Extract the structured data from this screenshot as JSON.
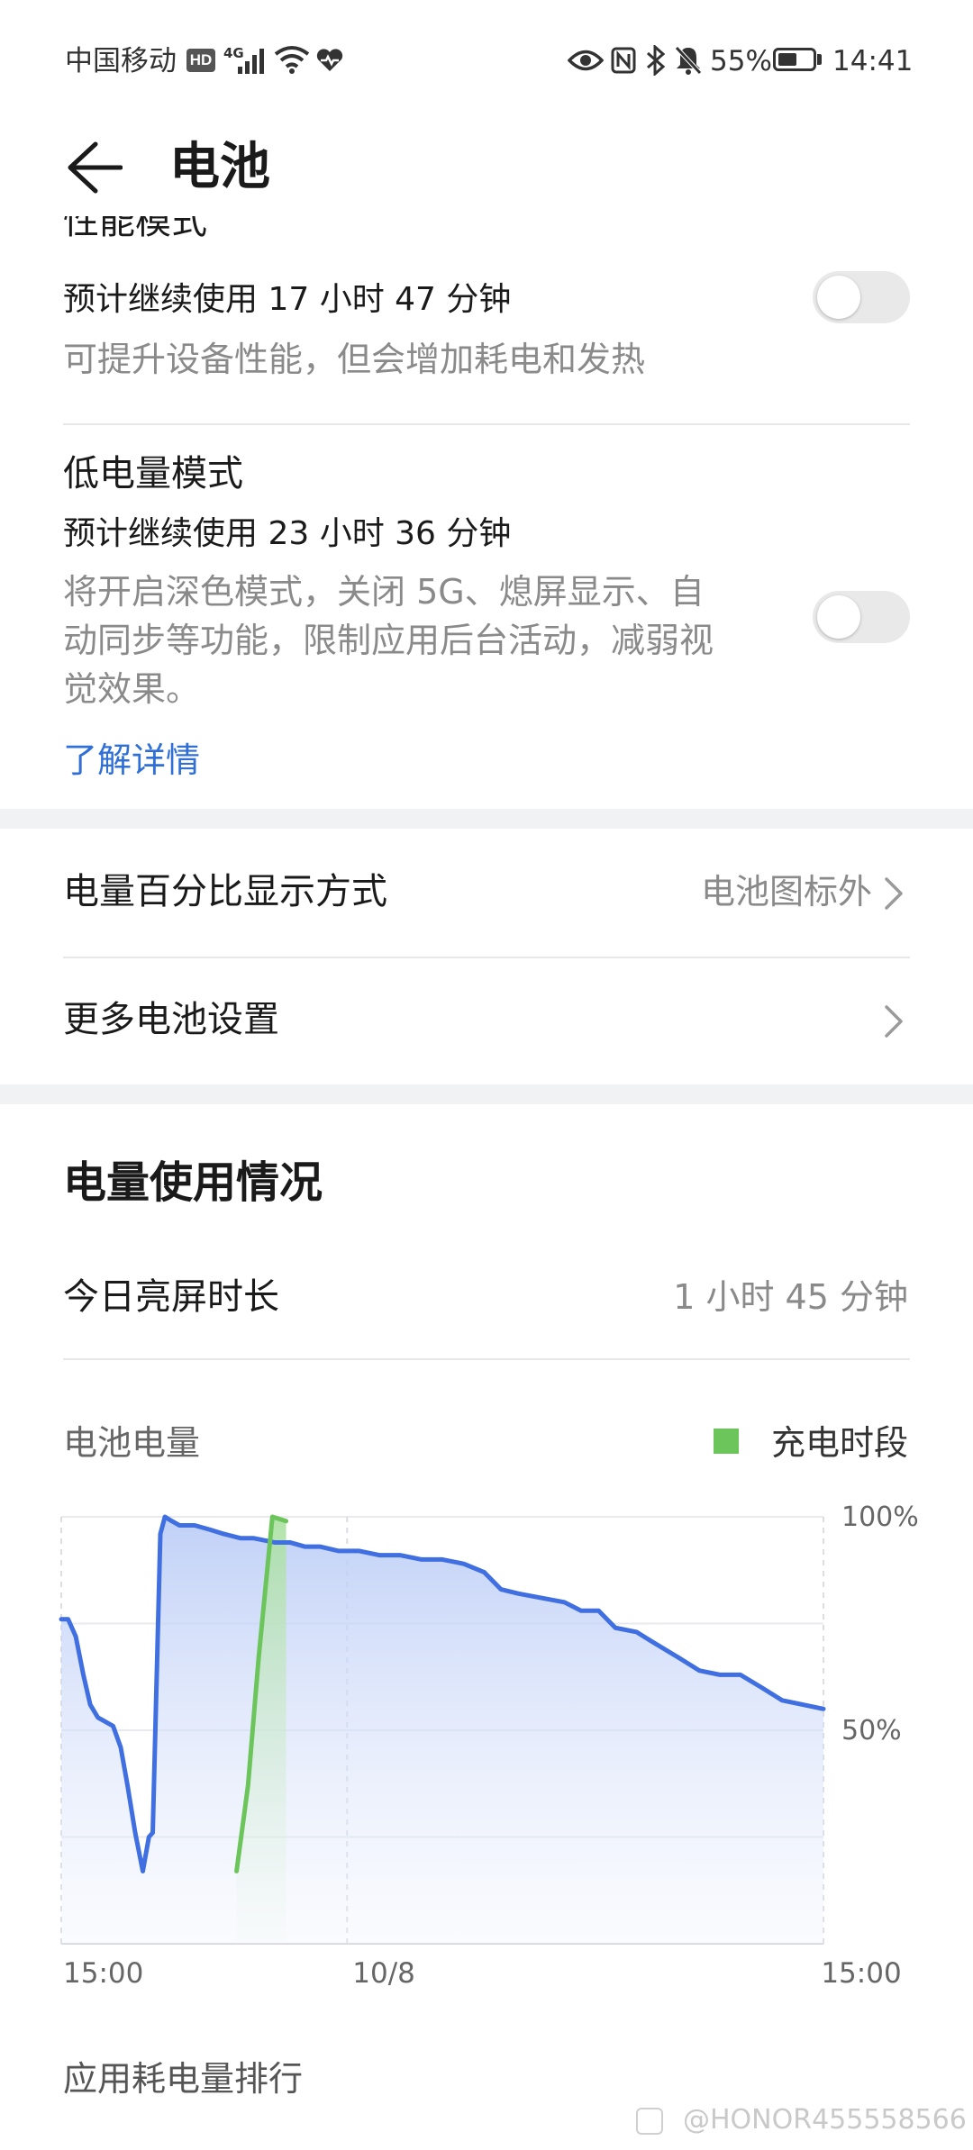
{
  "status_bar": {
    "carrier": "中国移动",
    "hd_badge": "HD",
    "network": "4G",
    "battery_percent": "55%",
    "time": "14:41",
    "battery_level": 0.55
  },
  "header": {
    "title": "电池"
  },
  "performance_mode": {
    "title": "性能模式",
    "estimate": "预计继续使用 17 小时 47 分钟",
    "description": "可提升设备性能，但会增加耗电和发热",
    "enabled": false
  },
  "low_power_mode": {
    "title": "低电量模式",
    "estimate": "预计继续使用 23 小时 36 分钟",
    "description_lines": [
      "将开启深色模式，关闭 5G、熄屏显示、自",
      "动同步等功能，限制应用后台活动，减弱视",
      "觉效果。"
    ],
    "enabled": false,
    "learn_more": "了解详情"
  },
  "settings": {
    "percentage_display": {
      "label": "电量百分比显示方式",
      "value": "电池图标外"
    },
    "more_settings": {
      "label": "更多电池设置"
    }
  },
  "usage": {
    "section_title": "电量使用情况",
    "screen_time_label": "今日亮屏时长",
    "screen_time_value": "1 小时 45 分钟",
    "chart_label": "电池电量",
    "charging_legend": "充电时段"
  },
  "colors": {
    "accent_link": "#2f6fd6",
    "usage_line": "#3f6fe0",
    "charging_line": "#6cc55b"
  },
  "chart_data": {
    "type": "area",
    "y_tick_labels": [
      "100%",
      "50%"
    ],
    "ylim": [
      0,
      100
    ],
    "x_tick_labels": [
      "15:00",
      "10/8",
      "15:00"
    ],
    "x_range_hours": [
      0,
      24
    ],
    "grid": true,
    "series": [
      {
        "name": "",
        "color": "#3f6fe0",
        "points": [
          [
            0,
            76
          ],
          [
            0.9,
            76
          ],
          [
            1.9,
            72
          ],
          [
            2.9,
            63
          ],
          [
            3.8,
            56
          ],
          [
            4.8,
            53
          ],
          [
            5.8,
            52
          ],
          [
            6.8,
            51
          ],
          [
            7.8,
            46
          ],
          [
            8.7,
            37
          ],
          [
            9.7,
            26
          ],
          [
            10.7,
            17
          ],
          [
            11.5,
            25
          ],
          [
            12,
            26
          ],
          [
            13,
            96
          ],
          [
            13.6,
            100
          ],
          [
            14.5,
            99
          ],
          [
            15.5,
            98
          ],
          [
            16.5,
            98
          ],
          [
            17.5,
            98
          ],
          [
            19.5,
            97
          ],
          [
            21.3,
            96
          ],
          [
            23.5,
            95
          ],
          [
            25.2,
            95
          ],
          [
            28,
            94
          ],
          [
            30,
            94
          ],
          [
            32,
            93
          ],
          [
            34,
            93
          ],
          [
            36.4,
            92
          ],
          [
            39.1,
            92
          ],
          [
            41.8,
            91
          ],
          [
            44.5,
            91
          ],
          [
            47.3,
            90
          ],
          [
            50,
            90
          ],
          [
            52.8,
            89
          ],
          [
            55.5,
            87
          ],
          [
            57.7,
            83
          ],
          [
            60,
            82
          ],
          [
            63,
            81
          ],
          [
            66,
            80
          ],
          [
            68.2,
            78
          ],
          [
            70.5,
            78
          ],
          [
            72.7,
            74
          ],
          [
            75.5,
            73
          ],
          [
            77.3,
            71
          ],
          [
            81,
            67
          ],
          [
            83.7,
            64
          ],
          [
            86.4,
            63
          ],
          [
            89.1,
            63
          ],
          [
            91.9,
            60
          ],
          [
            94.6,
            57
          ],
          [
            97.3,
            56
          ],
          [
            100,
            55
          ]
        ]
      },
      {
        "name": "充电时段",
        "color": "#6cc55b",
        "points": [
          [
            23,
            17
          ],
          [
            24.5,
            37
          ],
          [
            25.9,
            67
          ],
          [
            27.7,
            100
          ],
          [
            29.5,
            99
          ]
        ]
      }
    ],
    "charging_region": [
      23,
      29.5
    ]
  },
  "app_ranking": {
    "title": "应用耗电量排行"
  },
  "watermark": "@HONOR455558566"
}
